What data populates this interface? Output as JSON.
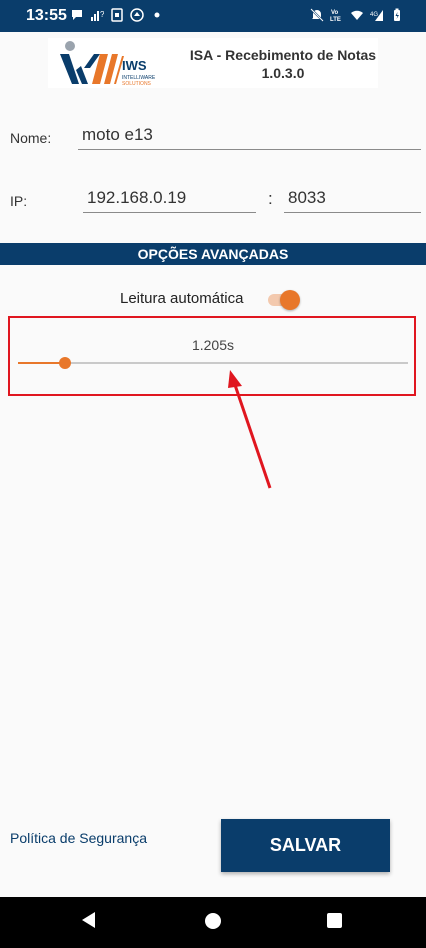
{
  "status_bar": {
    "time": "13:55",
    "left_icons": [
      "chat-icon",
      "signal-question-icon",
      "screenshot-icon",
      "maps-icon",
      "dot-icon"
    ],
    "right_icons": [
      "mute-icon",
      "volte-icon",
      "wifi-icon",
      "4g-signal-icon",
      "battery-icon"
    ],
    "volte_label": "Vo\nLTE",
    "network_label": "4G"
  },
  "header": {
    "logo_text": "IWS",
    "logo_subtext": "INTELLIWARE",
    "logo_subtext2": "SOLUTIONS",
    "title_line1": "ISA - Recebimento de Notas",
    "title_line2": "1.0.3.0"
  },
  "form": {
    "name_label": "Nome:",
    "name_value": "moto e13",
    "ip_label": "IP:",
    "ip_value": "192.168.0.19",
    "separator": ":",
    "port_value": "8033"
  },
  "advanced": {
    "title": "OPÇÕES AVANÇADAS",
    "auto_read_label": "Leitura automática",
    "auto_read_enabled": true,
    "slider_value_text": "1.205s",
    "slider_fraction": 0.12
  },
  "footer": {
    "policy_link": "Política de Segurança",
    "save_label": "SALVAR"
  },
  "colors": {
    "primary": "#0a3d6b",
    "accent": "#e8772a",
    "highlight": "#e0161f"
  }
}
